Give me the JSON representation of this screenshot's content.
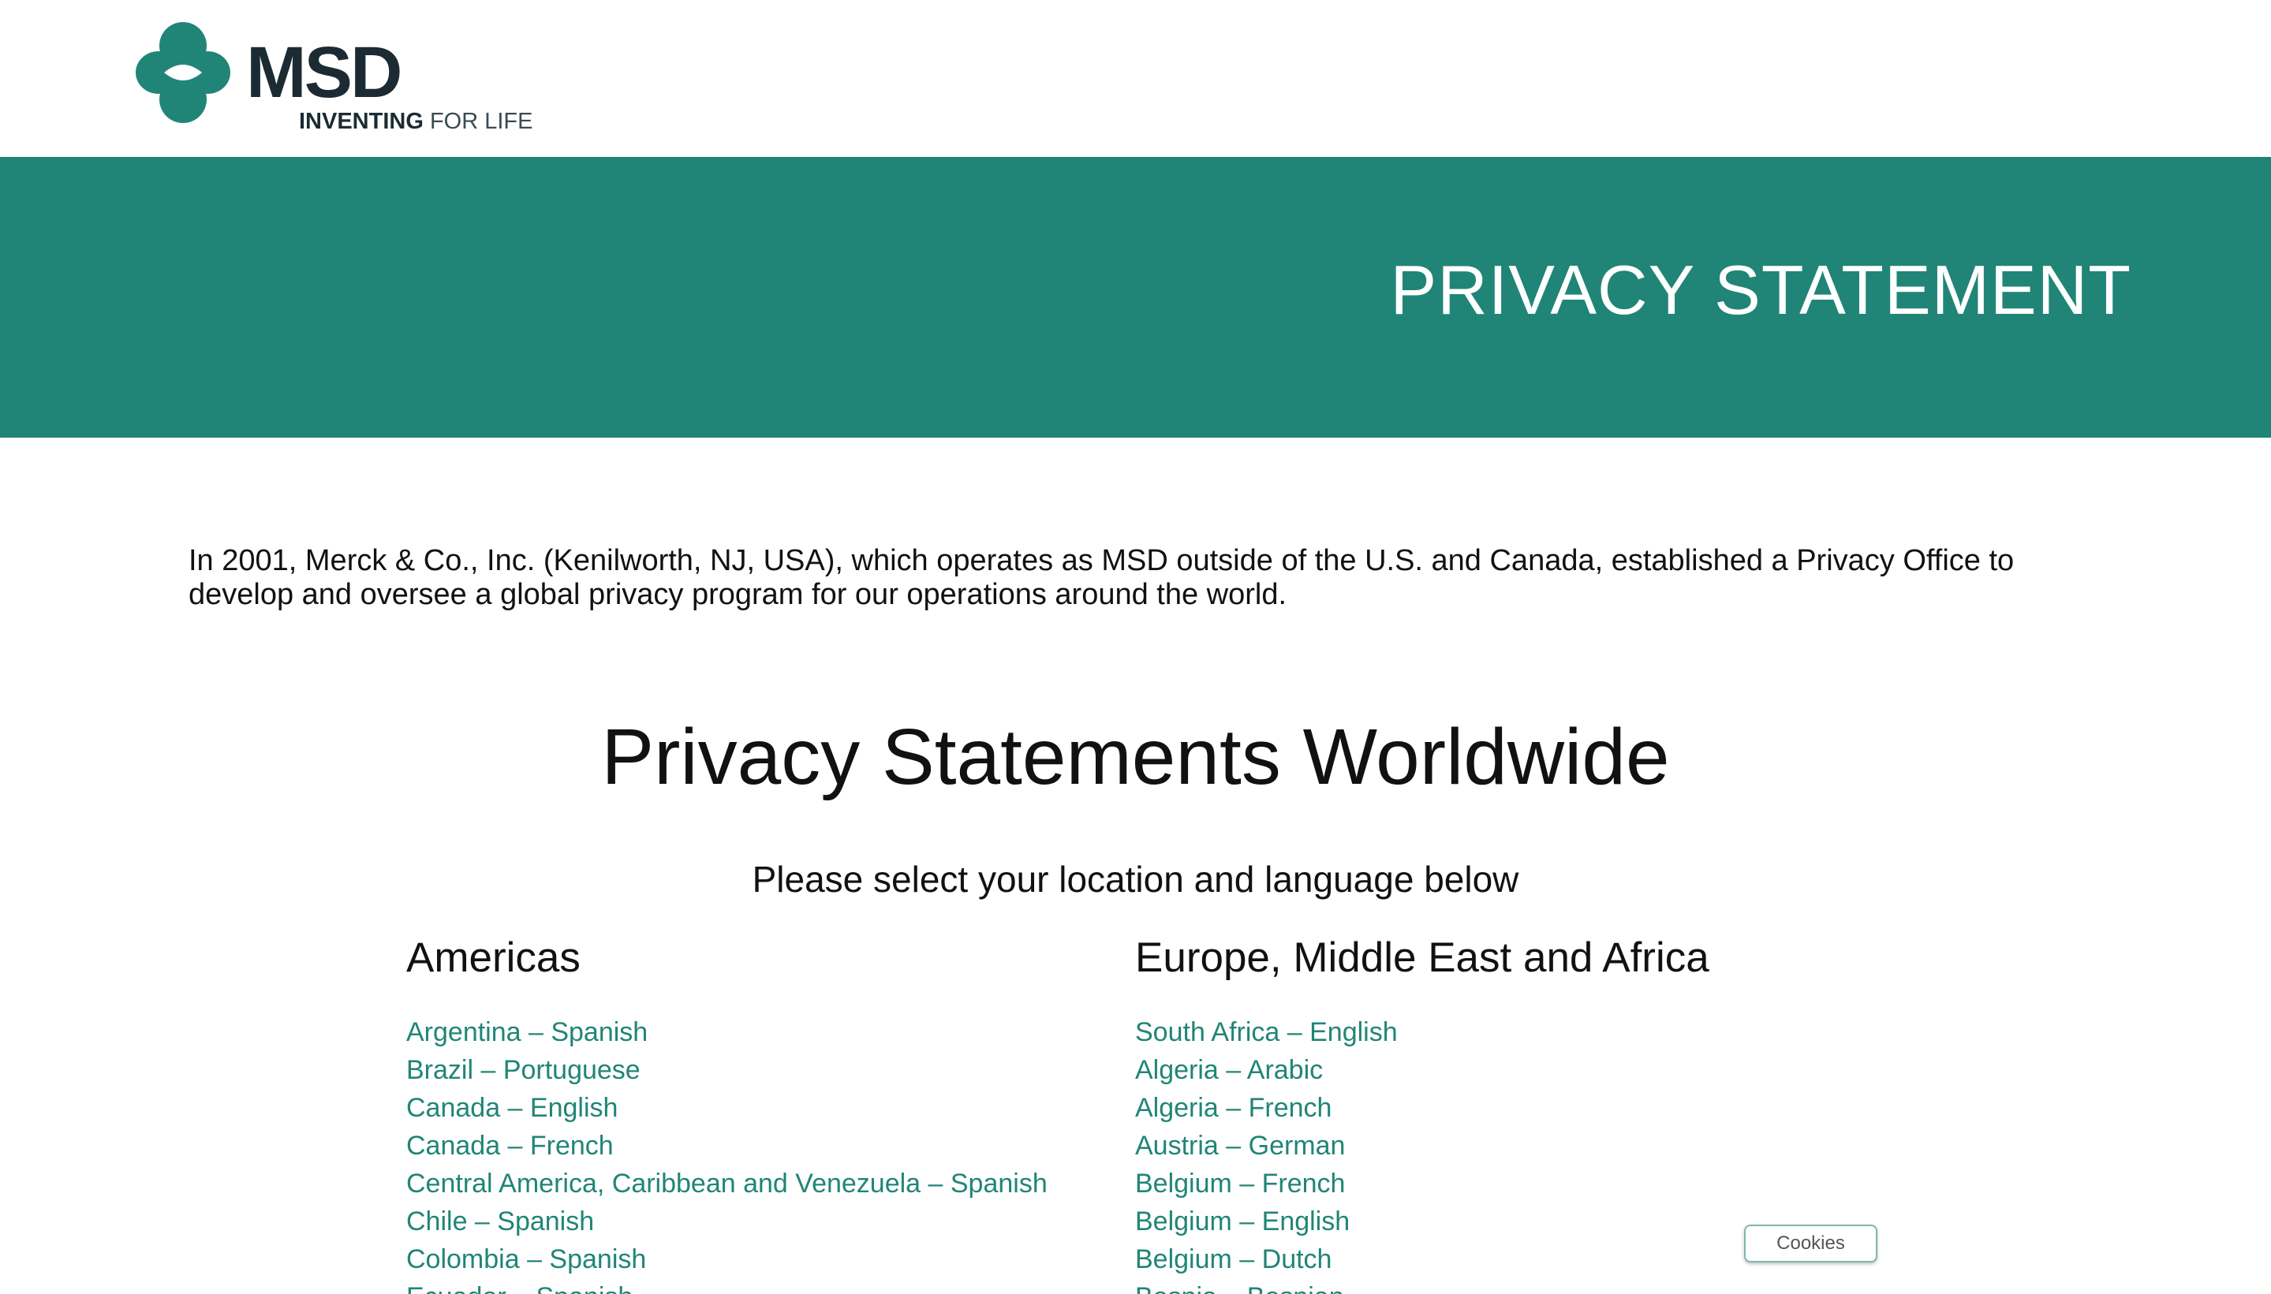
{
  "header": {
    "logo_word": "MSD",
    "logo_tagline_bold": "INVENTING",
    "logo_tagline_light": " FOR LIFE",
    "brand_color": "#208577"
  },
  "banner": {
    "title": "PRIVACY STATEMENT",
    "background": "#208577"
  },
  "intro": {
    "text": "In 2001, Merck & Co., Inc. (Kenilworth, NJ, USA), which operates as MSD outside of the U.S. and Canada, established a Privacy Office to develop and oversee a global privacy program for our operations around the world."
  },
  "worldwide": {
    "title": "Privacy Statements Worldwide",
    "subtitle": "Please select your location and language below"
  },
  "regions": [
    {
      "heading": "Americas",
      "links": [
        "Argentina – Spanish",
        "Brazil – Portuguese",
        "Canada – English",
        "Canada – French",
        "Central America, Caribbean and Venezuela – Spanish",
        "Chile – Spanish",
        "Colombia – Spanish",
        "Ecuador – Spanish"
      ]
    },
    {
      "heading": "Europe, Middle East and Africa",
      "links": [
        "South Africa – English",
        "Algeria – Arabic",
        "Algeria – French",
        "Austria – German",
        "Belgium – French",
        "Belgium – English",
        "Belgium – Dutch",
        "Bosnia – Bosnian"
      ]
    }
  ],
  "cookies_button": {
    "label": "Cookies"
  }
}
